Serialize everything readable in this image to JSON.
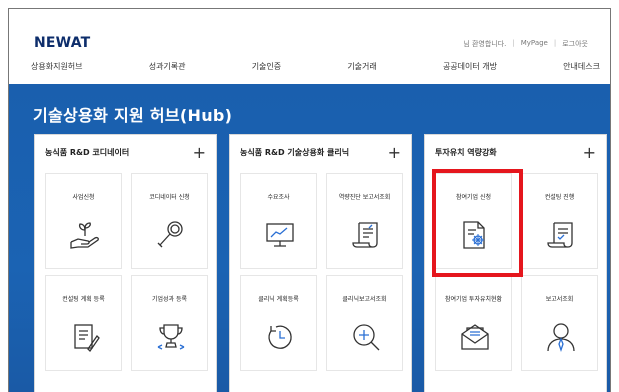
{
  "brand": {
    "logo": "NEWAT"
  },
  "utility": {
    "welcome": "님 환영합니다.",
    "mypage": "MyPage",
    "logout": "로그아웃"
  },
  "gnb": [
    "상용화지원허브",
    "성과기록관",
    "기술인증",
    "기술거래",
    "공공데이터 개방",
    "안내데스크"
  ],
  "hero": {
    "title": "기술상용화 지원 허브(Hub)"
  },
  "panels": [
    {
      "title": "농식품 R&D 코디네이터",
      "tiles": [
        {
          "label": "사업신청",
          "icon": "hand-plant-icon"
        },
        {
          "label": "코디네이터 신청",
          "icon": "magnifier-search-icon"
        },
        {
          "label": "컨설팅 계획 등록",
          "icon": "document-pen-icon"
        },
        {
          "label": "기업성과 등록",
          "icon": "trophy-icon"
        }
      ]
    },
    {
      "title": "농식품 R&D 기술상용화 클리닉",
      "tiles": [
        {
          "label": "수요조사",
          "icon": "monitor-chart-icon"
        },
        {
          "label": "역량진단 보고서조회",
          "icon": "scroll-document-icon"
        },
        {
          "label": "클리닉 계획등록",
          "icon": "clock-icon"
        },
        {
          "label": "클리닉보고서조회",
          "icon": "zoom-in-icon"
        }
      ]
    },
    {
      "title": "투자유치 역량강화",
      "tiles": [
        {
          "label": "참여기업 신청",
          "icon": "document-gear-icon"
        },
        {
          "label": "컨설팅 진행",
          "icon": "checklist-icon"
        },
        {
          "label": "참여기업 투자유치현황",
          "icon": "envelope-icon"
        },
        {
          "label": "보고서조회",
          "icon": "user-icon"
        }
      ]
    }
  ],
  "colors": {
    "hero_bg": "#1b63b3",
    "brand": "#0d2d6b",
    "highlight": "#e5161d"
  }
}
